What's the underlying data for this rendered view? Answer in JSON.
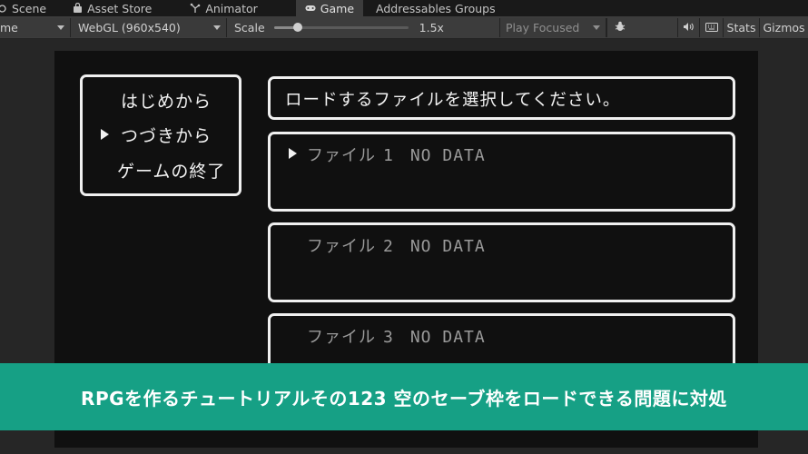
{
  "tabs": [
    {
      "label": "Scene",
      "icon": "scene-icon",
      "active": false
    },
    {
      "label": "Asset Store",
      "icon": "bag-icon",
      "active": false
    },
    {
      "label": "Animator",
      "icon": "animator-icon",
      "active": false
    },
    {
      "label": "Game",
      "icon": "gamepad-icon",
      "active": true
    },
    {
      "label": "Addressables Groups",
      "icon": "",
      "active": false
    }
  ],
  "toolbar": {
    "display_dropdown": "me",
    "resolution_dropdown": "WebGL (960x540)",
    "scale_label": "Scale",
    "scale_value": "1.5x",
    "scale_fraction": 0.18,
    "play_mode_dropdown": "Play Focused",
    "stats_label": "Stats",
    "gizmos_label": "Gizmos"
  },
  "game": {
    "menu": {
      "items": [
        "はじめから",
        "つづきから",
        "ゲームの終了"
      ],
      "selected_index": 1
    },
    "message": "ロードするファイルを選択してください。",
    "slots": [
      {
        "label": "ファイル",
        "number": "1",
        "status": "NO DATA",
        "selected": true
      },
      {
        "label": "ファイル",
        "number": "2",
        "status": "NO DATA",
        "selected": false
      },
      {
        "label": "ファイル",
        "number": "3",
        "status": "NO DATA",
        "selected": false
      }
    ]
  },
  "banner": {
    "text": "RPGを作るチュートリアルその123 空のセーブ枠をロードできる問題に対処",
    "color": "#16a085"
  }
}
